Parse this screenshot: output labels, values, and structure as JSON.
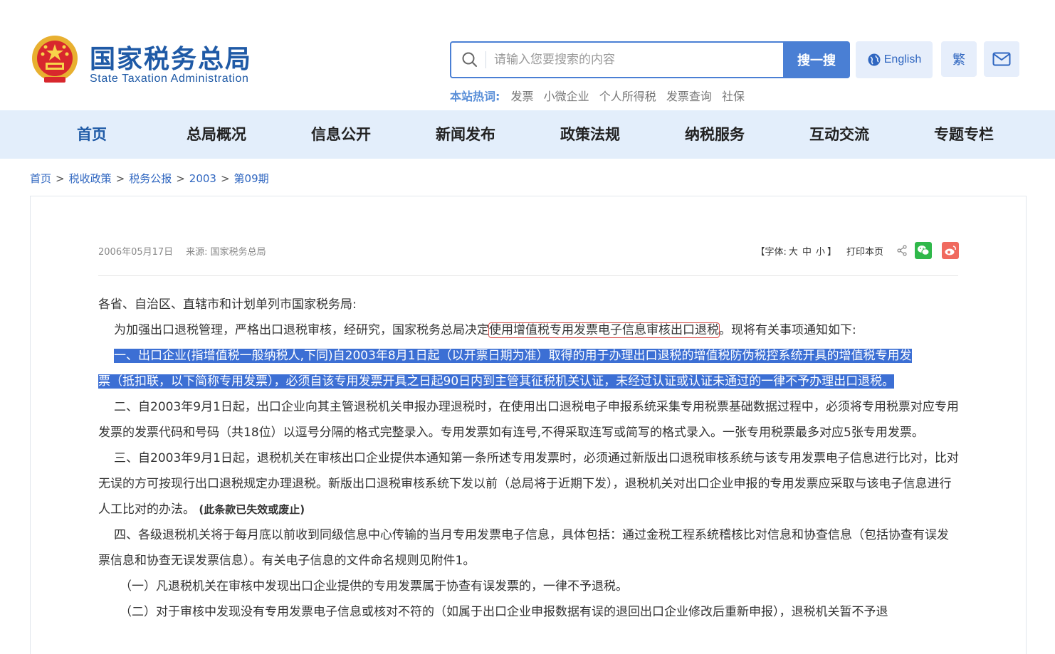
{
  "header": {
    "logo_cn": "国家税务总局",
    "logo_en": "State Taxation Administration",
    "search_placeholder": "请输入您要搜索的内容",
    "search_button": "搜一搜",
    "english_button": "English",
    "traditional_button": "繁",
    "hot_label": "本站热词:",
    "hot_words": [
      "发票",
      "小微企业",
      "个人所得税",
      "发票查询",
      "社保"
    ]
  },
  "nav": {
    "items": [
      "首页",
      "总局概况",
      "信息公开",
      "新闻发布",
      "政策法规",
      "纳税服务",
      "互动交流",
      "专题专栏"
    ]
  },
  "breadcrumb": [
    "首页",
    "税收政策",
    "税务公报",
    "2003",
    "第09期"
  ],
  "article": {
    "date": "2006年05月17日",
    "source": "来源: 国家税务总局",
    "font_label_open": "【字体:",
    "font_sizes": [
      "大",
      "中",
      "小"
    ],
    "font_label_close": "】",
    "print": "打印本页",
    "greeting": "各省、自治区、直辖市和计划单列市国家税务局:",
    "intro_pre": "为加强出口退税管理，严格出口退税审核，经研究，国家税务总局决定",
    "intro_highlight": "使用增值税专用发票电子信息审核出口退税",
    "intro_post": "。现将有关事项通知如下:",
    "item1_line1": "一、出口企业(指增值税一般纳税人,下同)自2003年8月1日起（以开票日期为准）取得的用于办理出口退税的增值税防伪税控系统开具的增值税专用发",
    "item1_line2": "票（抵扣联，以下简称专用发票），必须自该专用发票开具之日起90日内到主管其征税机关认证，未经过认证或认证未通过的一律不予办理出口退税。",
    "item2": "二、自2003年9月1日起，出口企业向其主管退税机关申报办理退税时，在使用出口退税电子申报系统采集专用税票基础数据过程中，必须将专用税票对应专用发票的发票代码和号码（共18位）以逗号分隔的格式完整录入。专用发票如有连号,不得采取连写或简写的格式录入。一张专用税票最多对应5张专用发票。",
    "item3": "三、自2003年9月1日起，退税机关在审核出口企业提供本通知第一条所述专用发票时，必须通过新版出口退税审核系统与该专用发票电子信息进行比对，比对无误的方可按现行出口退税规定办理退税。新版出口退税审核系统下发以前（总局将于近期下发），退税机关对出口企业申报的专用发票应采取与该电子信息进行人工比对的办法。",
    "item3_note": "(此条款已失效或废止)",
    "item4": "四、各级退税机关将于每月底以前收到同级信息中心传输的当月专用发票电子信息，具体包括：通过金税工程系统稽核比对信息和协查信息（包括协查有误发票信息和协查无误发票信息）。有关电子信息的文件命名规则见附件1。",
    "sub1": "（一）凡退税机关在审核中发现出口企业提供的专用发票属于协查有误发票的，一律不予退税。",
    "sub2": "（二）对于审核中发现没有专用发票电子信息或核对不符的（如属于出口企业申报数据有误的退回出口企业修改后重新申报），退税机关暂不予退"
  },
  "colors": {
    "brand": "#1f5aa6",
    "accent": "#4a7fd4",
    "nav_bg": "#e3eefb",
    "selection": "#3c6fd4",
    "highlight_border": "#d9534f"
  }
}
